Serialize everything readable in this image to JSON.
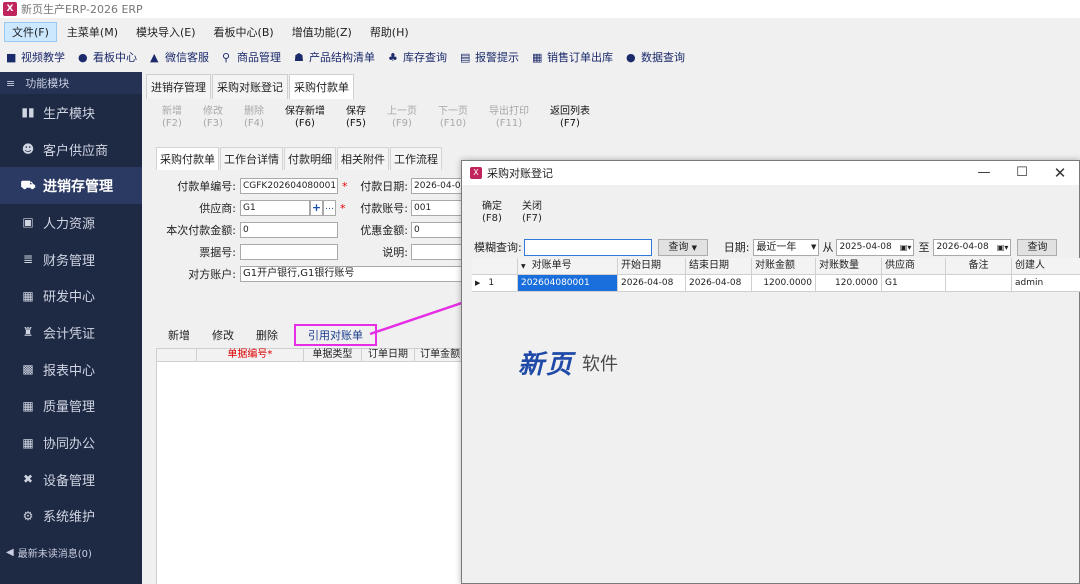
{
  "window": {
    "title": "新页生产ERP-2026 ERP",
    "icon": "app-logo-icon"
  },
  "menu": [
    "文件(F)",
    "主菜单(M)",
    "模块导入(E)",
    "看板中心(B)",
    "增值功能(Z)",
    "帮助(H)"
  ],
  "toolbar": [
    {
      "label": "视频教学",
      "icon": "video-icon"
    },
    {
      "label": "看板中心",
      "icon": "dashboard-icon"
    },
    {
      "label": "微信客服",
      "icon": "chat-icon"
    },
    {
      "label": "商品管理",
      "icon": "search-icon"
    },
    {
      "label": "产品结构清单",
      "icon": "tree-icon"
    },
    {
      "label": "库存查询",
      "icon": "org-icon"
    },
    {
      "label": "报警提示",
      "icon": "alert-icon"
    },
    {
      "label": "销售订单出库",
      "icon": "list-icon"
    },
    {
      "label": "数据查询",
      "icon": "chat-icon"
    }
  ],
  "sidebar": {
    "header": "功能模块",
    "items": [
      {
        "label": "生产模块",
        "icon": "book-icon"
      },
      {
        "label": "客户供应商",
        "icon": "users-icon"
      },
      {
        "label": "进销存管理",
        "icon": "cart-icon",
        "active": true
      },
      {
        "label": "人力资源",
        "icon": "id-card-icon"
      },
      {
        "label": "财务管理",
        "icon": "database-icon"
      },
      {
        "label": "研发中心",
        "icon": "grid-icon"
      },
      {
        "label": "会计凭证",
        "icon": "stamp-icon"
      },
      {
        "label": "报表中心",
        "icon": "chart-icon"
      },
      {
        "label": "质量管理",
        "icon": "grid-icon"
      },
      {
        "label": "协同办公",
        "icon": "grid-icon"
      },
      {
        "label": "设备管理",
        "icon": "tools-icon"
      },
      {
        "label": "系统维护",
        "icon": "gears-icon"
      }
    ],
    "footer": "最新未读消息(0)"
  },
  "main_tabs": [
    "进销存管理",
    "采购对账登记",
    "采购付款单"
  ],
  "actions": [
    {
      "label": "新增",
      "key": "(F2)",
      "enabled": false
    },
    {
      "label": "修改",
      "key": "(F3)",
      "enabled": false
    },
    {
      "label": "删除",
      "key": "(F4)",
      "enabled": false
    },
    {
      "label": "保存新增",
      "key": "(F6)",
      "enabled": true
    },
    {
      "label": "保存",
      "key": "(F5)",
      "enabled": true
    },
    {
      "label": "上一页",
      "key": "(F9)",
      "enabled": false
    },
    {
      "label": "下一页",
      "key": "(F10)",
      "enabled": false
    },
    {
      "label": "导出打印",
      "key": "(F11)",
      "enabled": false
    },
    {
      "label": "返回列表",
      "key": "(F7)",
      "enabled": true
    }
  ],
  "sub_tabs": [
    "采购付款单",
    "工作台详情",
    "付款明细",
    "相关附件",
    "工作流程"
  ],
  "form": {
    "payment_no_label": "付款单编号:",
    "payment_no": "CGFK202604080001",
    "payment_date_label": "付款日期:",
    "payment_date": "2026-04-08",
    "supplier_label": "供应商:",
    "supplier": "G1",
    "account_no_label": "付款账号:",
    "account_no": "001",
    "amount_label": "本次付款金额:",
    "amount": "0",
    "discount_label": "优惠金额:",
    "discount": "0",
    "invoice_label": "票据号:",
    "invoice": "",
    "note_label": "说明:",
    "note": "",
    "counter_account_label": "对方账户:",
    "counter_account": "G1开户银行,G1银行账号"
  },
  "detail_tools": [
    "新增",
    "修改",
    "删除",
    "引用对账单"
  ],
  "detail_grid_headers": [
    "单据编号*",
    "单据类型",
    "订单日期",
    "订单金额"
  ],
  "dialog": {
    "title": "采购对账登记",
    "actions": [
      {
        "label": "确定",
        "key": "(F8)"
      },
      {
        "label": "关闭",
        "key": "(F7)"
      }
    ],
    "fuzzy_label": "模糊查询:",
    "fuzzy_value": "",
    "query_btn": "查询",
    "date_label": "日期:",
    "date_range": "最近一年",
    "from_label": "从",
    "from_date": "2025-04-08",
    "to_label": "至",
    "to_date": "2026-04-08",
    "query_btn2": "查询",
    "columns": [
      "对账单号",
      "开始日期",
      "结束日期",
      "对账金额",
      "对账数量",
      "供应商",
      "备注",
      "创建人"
    ],
    "rows": [
      {
        "idx": "1",
        "no": "202604080001",
        "start": "2026-04-08",
        "end": "2026-04-08",
        "amount": "1200.0000",
        "qty": "120.0000",
        "supplier": "G1",
        "note": "",
        "creator": "admin"
      }
    ],
    "brand_main": "新页",
    "brand_sub": "软件"
  },
  "colors": {
    "sidebar_bg": "#1e2944",
    "highlight": "#e52ee5",
    "selection": "#1a6fdc"
  }
}
